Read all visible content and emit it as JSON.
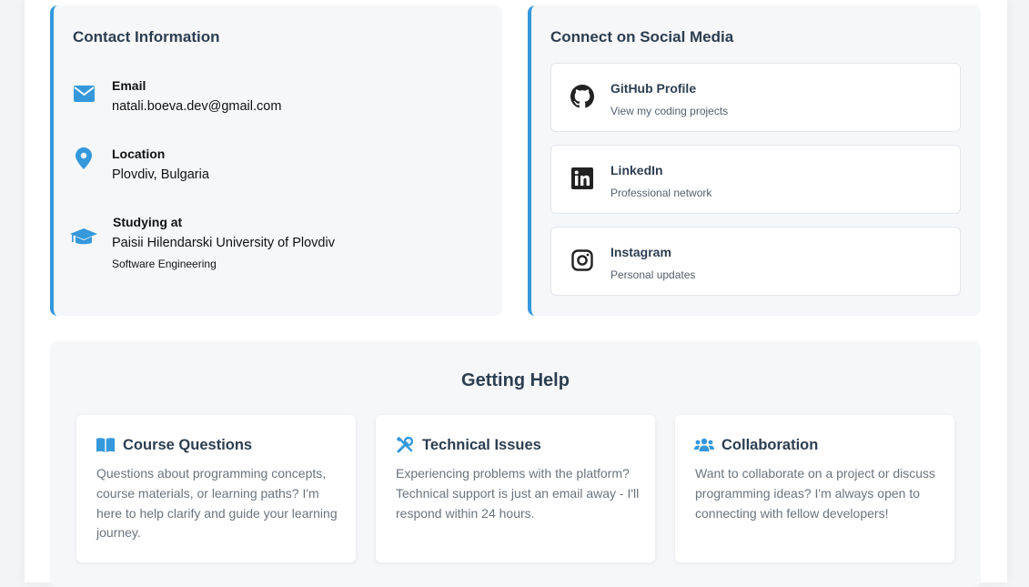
{
  "contact": {
    "title": "Contact Information",
    "items": [
      {
        "label": "Email",
        "value": "natali.boeva.dev@gmail.com",
        "icon": "envelope-icon"
      },
      {
        "label": "Location",
        "value": "Plovdiv, Bulgaria",
        "icon": "map-pin-icon"
      },
      {
        "label": "Studying at",
        "value": "Paisii Hilendarski University of Plovdiv",
        "sub": "Software Engineering",
        "icon": "graduation-cap-icon"
      }
    ]
  },
  "social": {
    "title": "Connect on Social Media",
    "links": [
      {
        "name": "GitHub Profile",
        "desc": "View my coding projects",
        "icon": "github-icon"
      },
      {
        "name": "LinkedIn",
        "desc": "Professional network",
        "icon": "linkedin-icon"
      },
      {
        "name": "Instagram",
        "desc": "Personal updates",
        "icon": "instagram-icon"
      }
    ]
  },
  "help": {
    "title": "Getting Help",
    "cards": [
      {
        "title": "Course Questions",
        "text": "Questions about programming concepts, course materials, or learning paths? I'm here to help clarify and guide your learning journey.",
        "icon": "book-icon"
      },
      {
        "title": "Technical Issues",
        "text": "Experiencing problems with the platform? Technical support is just an email away - I'll respond within 24 hours.",
        "icon": "tools-icon"
      },
      {
        "title": "Collaboration",
        "text": "Want to collaborate on a project or discuss programming ideas? I'm always open to connecting with fellow developers!",
        "icon": "users-icon"
      }
    ]
  },
  "colors": {
    "accent": "#3498db",
    "heading": "#2c3e50",
    "muted": "#6b737d",
    "card_bg": "#f6f7f9"
  }
}
